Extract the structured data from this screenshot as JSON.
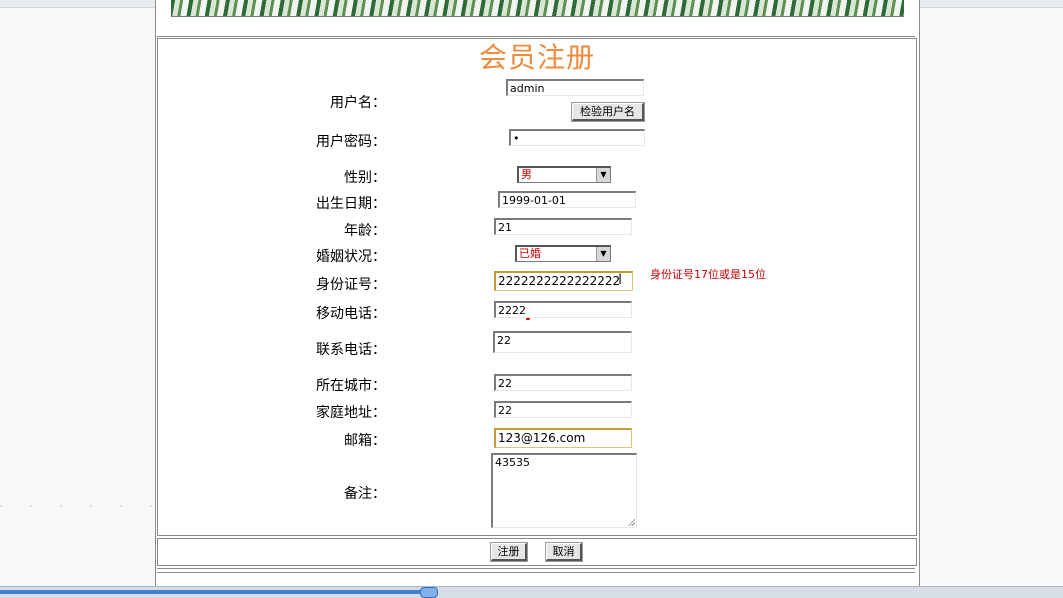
{
  "page": {
    "title": "会员注册"
  },
  "form": {
    "username_label": "用户名：",
    "username_value": "admin",
    "check_username_button": "检验用户名",
    "password_label": "用户密码：",
    "password_value": "•",
    "gender_label": "性别：",
    "gender_value": "男",
    "birthdate_label": "出生日期：",
    "birthdate_value": "1999-01-01",
    "age_label": "年龄：",
    "age_value": "21",
    "marital_label": "婚姻状况：",
    "marital_value": "已婚",
    "idcard_label": "身份证号：",
    "idcard_value": "2222222222222222",
    "idcard_error": "身份证号17位或是15位",
    "mobile_label": "移动电话：",
    "mobile_value": "2222",
    "phone_label": "联系电话：",
    "phone_value": "22",
    "city_label": "所在城市：",
    "city_value": "22",
    "address_label": "家庭地址：",
    "address_value": "22",
    "email_label": "邮箱：",
    "email_value": "123@126.com",
    "remark_label": "备注：",
    "remark_value": "43535"
  },
  "actions": {
    "submit_label": "注册",
    "cancel_label": "取消"
  },
  "colors": {
    "title": "#f08a3c",
    "error": "#cc0000"
  }
}
